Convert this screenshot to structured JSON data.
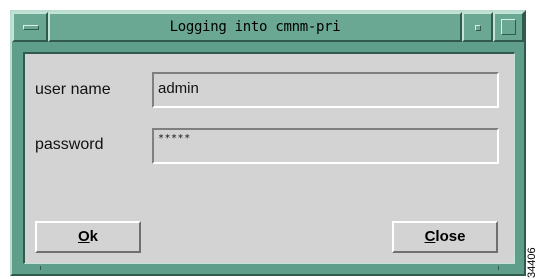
{
  "window": {
    "title": "Logging into cmnm-pri"
  },
  "form": {
    "username_label": "user name",
    "username_value": "admin",
    "password_label": "password",
    "password_value": "*****"
  },
  "buttons": {
    "ok": {
      "mnemonic": "O",
      "rest": "k"
    },
    "close": {
      "mnemonic": "C",
      "rest": "lose"
    }
  },
  "figure_id": "34406",
  "colors": {
    "frame": "#5f9e8a",
    "titlebar": "#6aa893",
    "dialog_background": "#d3d3d3"
  },
  "icons": {
    "window_menu": "window-menu-icon",
    "minimize": "minimize-icon",
    "maximize": "maximize-icon"
  }
}
